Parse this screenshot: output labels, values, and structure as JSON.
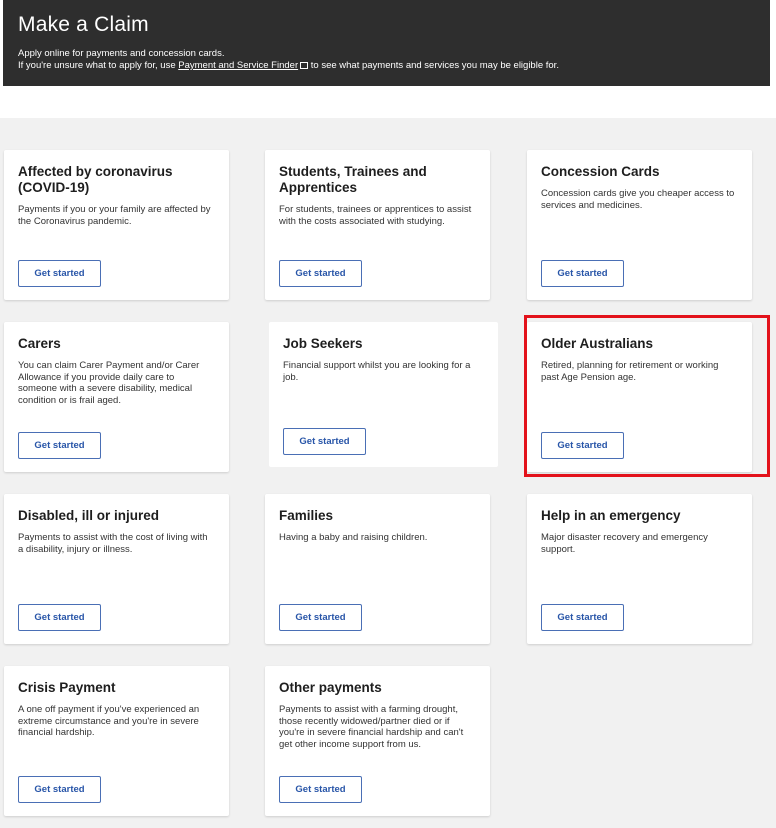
{
  "header": {
    "title": "Make a Claim",
    "line1": "Apply online for payments and concession cards.",
    "line2_prefix": "If you're unsure what to apply for, use ",
    "link_text": "Payment and Service Finder",
    "line2_suffix": " to see what payments and services you may be eligible for."
  },
  "button_label": "Get started",
  "cards": [
    {
      "title": "Affected by coronavirus (COVID-19)",
      "description": "Payments if you or your family are affected by the Coronavirus pandemic.",
      "button": "Get started"
    },
    {
      "title": "Students, Trainees and Apprentices",
      "description": "For students, trainees or apprentices to assist with the costs associated with studying.",
      "button": "Get started"
    },
    {
      "title": "Concession Cards",
      "description": "Concession cards give you cheaper access to services and medicines.",
      "button": "Get started"
    },
    {
      "title": "Carers",
      "description": "You can claim Carer Payment and/or Carer Allowance if you provide daily care to someone with a severe disability, medical condition or is frail aged.",
      "button": "Get started"
    },
    {
      "title": "Job Seekers",
      "description": "Financial support whilst you are looking for a job.",
      "button": "Get started"
    },
    {
      "title": "Older Australians",
      "description": "Retired, planning for retirement or working past Age Pension age.",
      "button": "Get started"
    },
    {
      "title": "Disabled, ill or injured",
      "description": "Payments to assist with the cost of living with a disability, injury or illness.",
      "button": "Get started"
    },
    {
      "title": "Families",
      "description": "Having a baby and raising children.",
      "button": "Get started"
    },
    {
      "title": "Help in an emergency",
      "description": "Major disaster recovery and emergency support.",
      "button": "Get started"
    },
    {
      "title": "Crisis Payment",
      "description": "A one off payment if you've experienced an extreme circumstance and you're in severe financial hardship.",
      "button": "Get started"
    },
    {
      "title": "Other payments",
      "description": "Payments to assist with a farming drought, those recently widowed/partner died or if you're in severe financial hardship and can't get other income support from us.",
      "button": "Get started"
    }
  ],
  "colors": {
    "header_bg": "#2e2e2e",
    "page_bg": "#f1f1f1",
    "button_border": "#4a6fb5",
    "button_text": "#2855a8",
    "highlight": "#e3121b"
  }
}
